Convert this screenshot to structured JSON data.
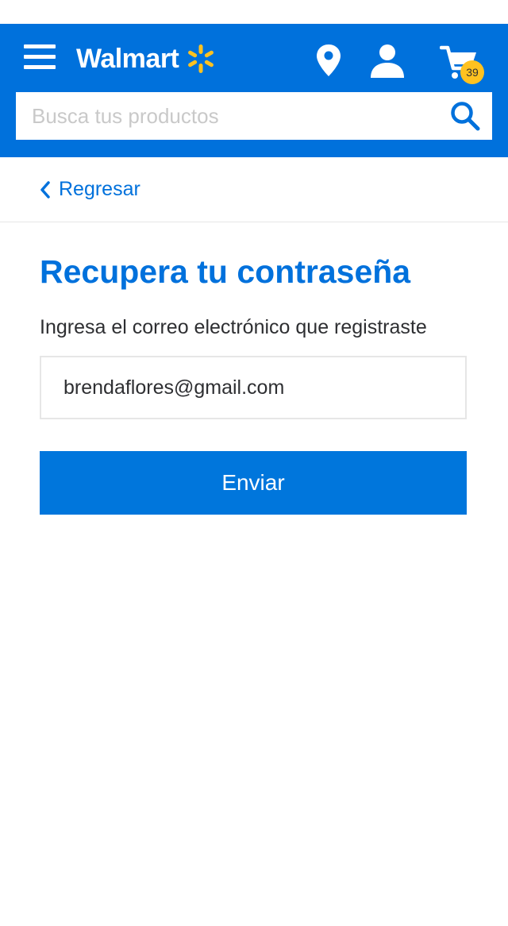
{
  "header": {
    "logo_text": "Walmart",
    "cart_count": "39",
    "colors": {
      "brand_blue": "#0071dc",
      "spark_yellow": "#ffc220"
    },
    "icons": [
      "menu-icon",
      "walmart-spark-icon",
      "location-pin-icon",
      "account-icon",
      "cart-icon",
      "search-icon"
    ]
  },
  "search": {
    "placeholder": "Busca tus productos",
    "value": ""
  },
  "nav": {
    "back_label": "Regresar"
  },
  "main": {
    "title": "Recupera tu contraseña",
    "instruction": "Ingresa el correo electrónico que registraste",
    "email_value": "brendaflores@gmail.com",
    "submit_label": "Enviar"
  }
}
